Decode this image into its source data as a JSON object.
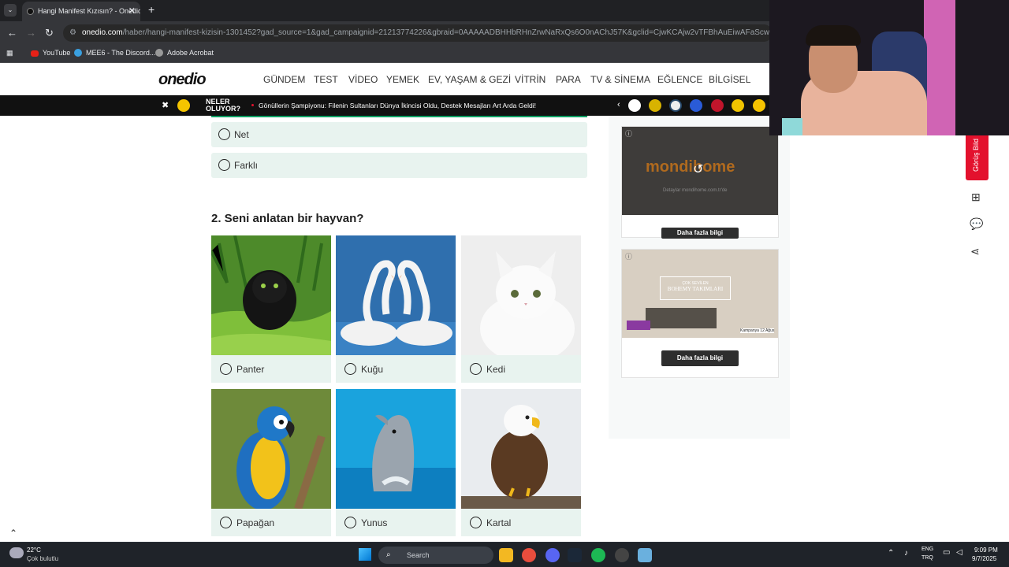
{
  "browser": {
    "tab_title": "Hangi Manifest Kızısın? - Onedio",
    "url_host": "onedio.com",
    "url_path": "/haber/hangi-manifest-kizisin-1301452?gad_source=1&gad_campaignid=21213774226&gbraid=0AAAAADBHHbRHnZrwNaRxQs6O0nAChJ57K&gclid=CjwKCAjw2vTFBhAuEiwAFaScwp3CbpALbzENlBC",
    "bookmarks": [
      "YouTube",
      "MEE6 - The Discord...",
      "Adobe Acrobat"
    ]
  },
  "header": {
    "logo": "onedio",
    "menu": [
      "GÜNDEM",
      "TEST",
      "VİDEO",
      "YEMEK",
      "EV, YAŞAM & GEZİ",
      "VİTRİN",
      "PARA",
      "TV & SİNEMA",
      "EĞLENCE",
      "BİLGİSEL"
    ]
  },
  "ticker": {
    "label_line1": "NELER",
    "label_line2": "OLUYOR?",
    "headline": "Gönüllerin Şampiyonu: Filenin Sultanları Dünya İkincisi Oldu, Destek Mesajları Art Arda Geldi!"
  },
  "quiz": {
    "prev_options": [
      "Net",
      "Farklı"
    ],
    "question2": "2. Seni anlatan bir hayvan?",
    "animals": [
      "Panter",
      "Kuğu",
      "Kedi",
      "Papağan",
      "Yunus",
      "Kartal"
    ]
  },
  "ads": [
    {
      "brand": "mondihome",
      "sub": "Detaylar mondihome.com.tr'de",
      "button": "Daha fazla bilgi"
    },
    {
      "line1": "ÇOK SEVİLEN",
      "line2": "BOHEMY TAKIMLARI",
      "footer": "Kampanya 12 Ağus",
      "button": "Daha fazla bilgi"
    }
  ],
  "side_tab": "Görüş Bild",
  "taskbar": {
    "temp": "22°C",
    "weather": "Çok bulutlu",
    "search": "Search",
    "lang1": "ENG",
    "lang2": "TRQ",
    "time": "9:09 PM",
    "date": "9/7/2025"
  }
}
